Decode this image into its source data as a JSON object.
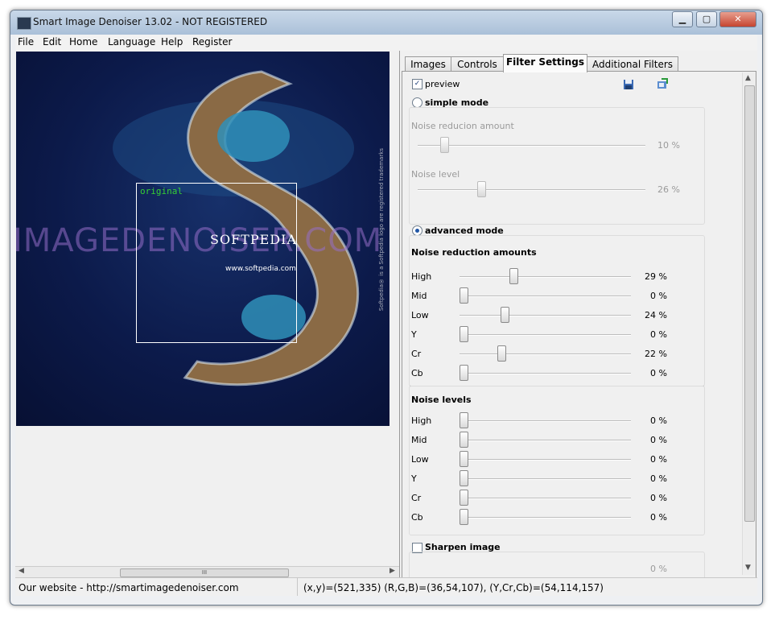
{
  "window": {
    "title": "Smart Image Denoiser 13.02 - NOT REGISTERED",
    "controls": [
      "▁",
      "▢",
      "✕"
    ]
  },
  "menu": [
    "File",
    "Edit",
    "Home",
    "Language",
    "Help",
    "Register"
  ],
  "preview": {
    "original_label": "original",
    "watermark_big": "IMAGEDENOISER.COM",
    "watermark_brand": "SOFTPEDIA",
    "watermark_url": "www.softpedia.com",
    "watermark_vertical": "Softpedia® is a Softpedia logo are registered trademarks",
    "scroll_grip": "III"
  },
  "tabs": [
    "Images",
    "Controls",
    "Filter Settings",
    "Additional Filters"
  ],
  "filter": {
    "preview_label": "preview",
    "preview_checked": true,
    "simple_mode": {
      "label": "simple mode",
      "selected": false,
      "noise_reduction_label": "Noise reducion amount",
      "noise_reduction_value": 10,
      "noise_reduction_pct": "10 %",
      "noise_level_label": "Noise level",
      "noise_level_value": 26,
      "noise_level_pct": "26 %"
    },
    "advanced_mode": {
      "label": "advanced mode",
      "selected": true,
      "reduction_title": "Noise reduction amounts",
      "reduction": [
        {
          "label": "High",
          "value": 29,
          "pct": "29 %"
        },
        {
          "label": "Mid",
          "value": 0,
          "pct": "0 %"
        },
        {
          "label": "Low",
          "value": 24,
          "pct": "24 %"
        },
        {
          "label": "Y",
          "value": 0,
          "pct": "0 %"
        },
        {
          "label": "Cr",
          "value": 22,
          "pct": "22 %"
        },
        {
          "label": "Cb",
          "value": 0,
          "pct": "0 %"
        }
      ],
      "levels_title": "Noise levels",
      "levels": [
        {
          "label": "High",
          "value": 0,
          "pct": "0 %"
        },
        {
          "label": "Mid",
          "value": 0,
          "pct": "0 %"
        },
        {
          "label": "Low",
          "value": 0,
          "pct": "0 %"
        },
        {
          "label": "Y",
          "value": 0,
          "pct": "0 %"
        },
        {
          "label": "Cr",
          "value": 0,
          "pct": "0 %"
        },
        {
          "label": "Cb",
          "value": 0,
          "pct": "0 %"
        }
      ]
    },
    "sharpen": {
      "label": "Sharpen image",
      "checked": false,
      "value_pct": "0 %"
    }
  },
  "status": {
    "website": "Our website - http://smartimagedenoiser.com",
    "pixel_info": "(x,y)=(521,335) (R,G,B)=(36,54,107), (Y,Cr,Cb)=(54,114,157)"
  }
}
